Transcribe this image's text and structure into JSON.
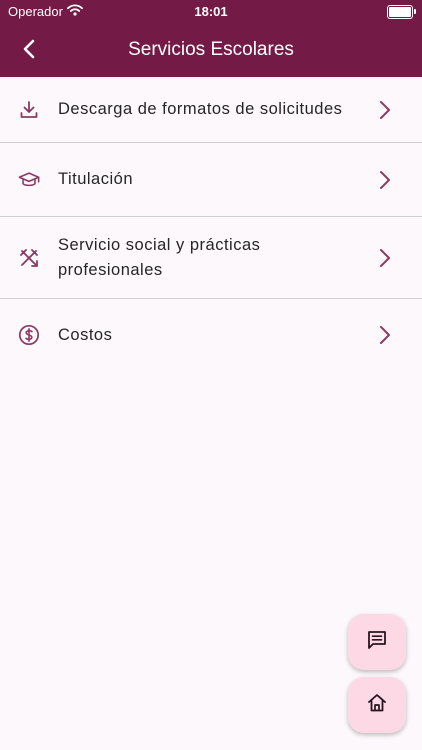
{
  "status_bar": {
    "carrier": "Operador",
    "time": "18:01"
  },
  "header": {
    "title": "Servicios Escolares",
    "back_icon": "chevron-left-icon"
  },
  "menu": {
    "items": [
      {
        "label": "Descarga de formatos de solicitudes",
        "icon": "download-icon"
      },
      {
        "label": "Titulación",
        "icon": "graduation-cap-icon"
      },
      {
        "label": "Servicio social y prácticas profesionales",
        "icon": "tools-icon"
      },
      {
        "label": "Costos",
        "icon": "dollar-circle-icon"
      }
    ]
  },
  "fabs": {
    "chat_icon": "chat-icon",
    "home_icon": "home-icon"
  },
  "colors": {
    "primary": "#731a47",
    "background": "#fdf8fb",
    "fab_background": "#fcd9e5",
    "divider": "#cfcfcf"
  }
}
